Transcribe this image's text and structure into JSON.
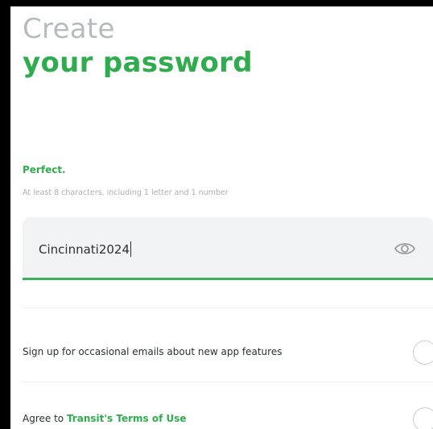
{
  "header": {
    "title_line1": "Create",
    "title_line2": "your password"
  },
  "password": {
    "strength_text": "Perfect.",
    "hint": "At least 8 characters, including 1 letter and 1 number",
    "value": "Cincinnati2024",
    "visibility_icon": "eye-icon"
  },
  "options": {
    "emails_label": "Sign up for occasional emails about new app features",
    "terms_prefix": "Agree to ",
    "terms_link": "Transit's Terms of Use"
  },
  "colors": {
    "accent": "#2fad4e",
    "title_gray": "#b5bbbf",
    "field_bg": "#f1f3f4"
  }
}
